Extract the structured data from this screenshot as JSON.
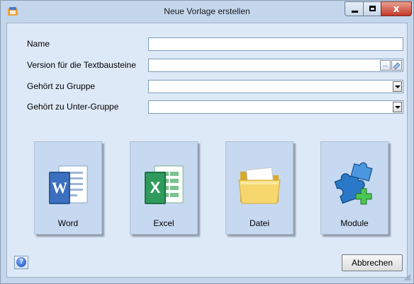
{
  "window": {
    "title": "Neue Vorlage erstellen",
    "close_symbol": "x"
  },
  "form": {
    "name_label": "Name",
    "name_value": "",
    "version_label": "Version für die Textbausteine",
    "version_value": "",
    "version_browse_symbol": "...",
    "group_label": "Gehört zu Gruppe",
    "group_value": "",
    "subgroup_label": "Gehört zu Unter-Gruppe",
    "subgroup_value": ""
  },
  "tiles": [
    {
      "label": "Word",
      "icon": "word-icon"
    },
    {
      "label": "Excel",
      "icon": "excel-icon"
    },
    {
      "label": "Datei",
      "icon": "folder-icon"
    },
    {
      "label": "Module",
      "icon": "puzzle-add-icon"
    }
  ],
  "footer": {
    "help_symbol": "?",
    "cancel_label": "Abbrechen"
  },
  "colors": {
    "background": "#c3d6ec",
    "panel": "#dde9f7",
    "tile": "#c6d9f1",
    "close_button": "#c4372a",
    "word_blue": "#2b5797",
    "excel_green": "#1e7145",
    "folder_yellow": "#f5d76e",
    "puzzle_blue": "#2a79c9",
    "plus_green": "#3cb043"
  }
}
